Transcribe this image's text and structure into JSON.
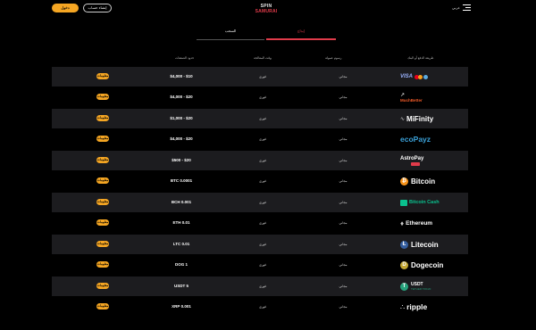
{
  "header": {
    "login_label": "دخول",
    "register_label": "إنشاء حساب",
    "logo_top": "SPIN",
    "logo_bottom": "SAMURAI",
    "language": "عربي"
  },
  "tabs": {
    "withdraw": "السحب",
    "deposit": "إيداع"
  },
  "columns": {
    "method": "طريقة الدفع أو البنك",
    "fee": "رسوم عمولة",
    "time": "وقت المعالجة",
    "limits": "حدود الصفقات"
  },
  "info_label": "معلومات",
  "rows": [
    {
      "method": "VISA",
      "limits": "$4,000 - $10",
      "time": "فوري",
      "fee": "مجاني"
    },
    {
      "method": "MuchBetter",
      "limits": "$4,000 - $20",
      "time": "فوري",
      "fee": "مجاني"
    },
    {
      "method": "MiFinity",
      "limits": "$1,000 - $20",
      "time": "فوري",
      "fee": "مجاني"
    },
    {
      "method": "ecoPayz",
      "limits": "$4,000 - $20",
      "time": "فوري",
      "fee": "مجاني"
    },
    {
      "method": "AstroPay",
      "limits": "$500 - $20",
      "time": "فوري",
      "fee": "مجاني"
    },
    {
      "method": "Bitcoin",
      "limits": "BTC 0.0001",
      "time": "فوري",
      "fee": "مجاني"
    },
    {
      "method": "Bitcoin Cash",
      "limits": "BCH 0.001",
      "time": "فوري",
      "fee": "مجاني"
    },
    {
      "method": "Ethereum",
      "limits": "ETH 0.01",
      "time": "فوري",
      "fee": "مجاني"
    },
    {
      "method": "Litecoin",
      "limits": "LTC 0.01",
      "time": "فوري",
      "fee": "مجاني"
    },
    {
      "method": "Dogecoin",
      "limits": "DOG 1",
      "time": "فوري",
      "fee": "مجاني"
    },
    {
      "method": "USDT",
      "method_sub": "TETHER TRC20",
      "limits": "USDT 5",
      "time": "فوري",
      "fee": "مجاني"
    },
    {
      "method": "ripple",
      "limits": "XRP 0.001",
      "time": "فوري",
      "fee": "مجاني"
    }
  ],
  "colors": {
    "accent": "#f5a623",
    "brand_red": "#e03b4a",
    "row_alt": "#1c1c1f",
    "bitcoin": "#f7931a",
    "bitcoin_cash": "#0ac18e",
    "ecopayz": "#3ba1d8",
    "litecoin": "#345d9d",
    "dogecoin": "#c2a633",
    "usdt": "#26a17b",
    "ripple": "#ffffff"
  }
}
